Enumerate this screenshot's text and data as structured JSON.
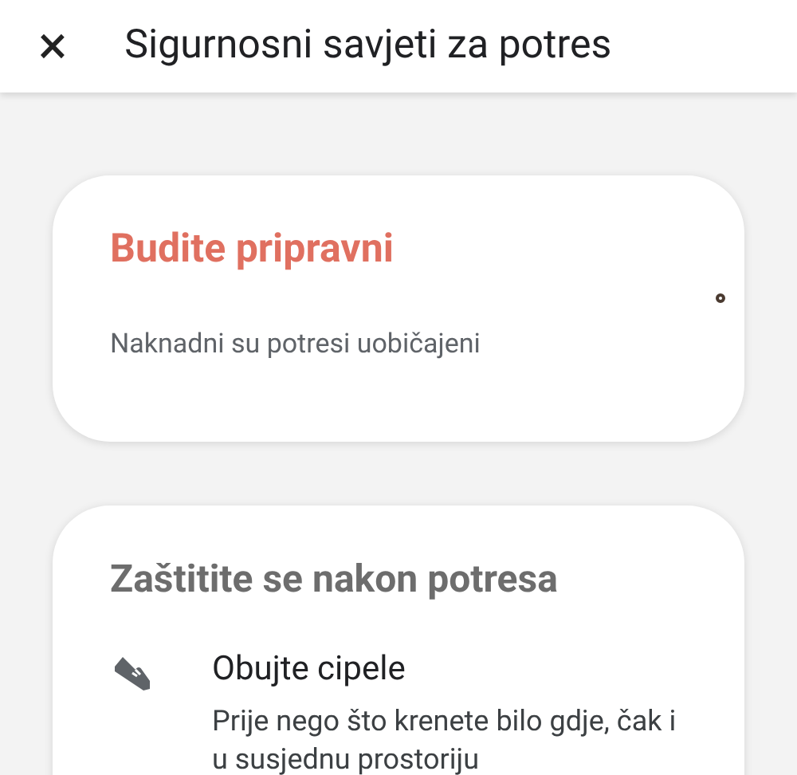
{
  "header": {
    "close": "×",
    "title": "Sigurnosni savjeti za potres"
  },
  "cards": [
    {
      "kind": "intro",
      "title": "Budite pripravni",
      "subtitle": "Naknadni su potresi uobičajeni"
    },
    {
      "kind": "tips",
      "title": "Zaštitite se nakon potresa",
      "items": [
        {
          "title": "Obujte cipele",
          "text": "Prije nego što krenete bilo gdje, čak i u susjednu prostoriju"
        }
      ]
    }
  ]
}
